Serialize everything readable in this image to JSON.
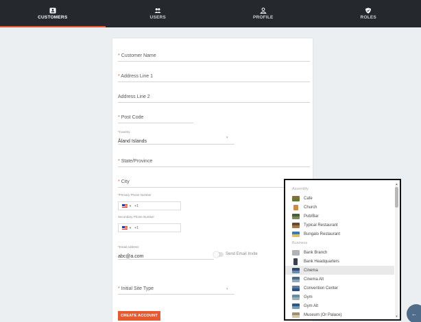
{
  "nav": {
    "tabs": [
      {
        "label": "CUSTOMERS",
        "icon": "id-card-icon",
        "active": true
      },
      {
        "label": "USERS",
        "icon": "users-icon",
        "active": false
      },
      {
        "label": "PROFILE",
        "icon": "user-icon",
        "active": false
      },
      {
        "label": "ROLES",
        "icon": "shield-icon",
        "active": false
      }
    ]
  },
  "form": {
    "customer_name": {
      "label": "Customer Name",
      "required": "*"
    },
    "address1": {
      "label": "Address Line 1",
      "required": "*"
    },
    "address2": {
      "label": "Address Line 2"
    },
    "post_code": {
      "label": "Post Code",
      "required": "*"
    },
    "country": {
      "label": "Country",
      "required": "*",
      "value": "Åland Islands"
    },
    "state": {
      "label": "State/Province",
      "required": "*"
    },
    "city": {
      "label": "City",
      "required": "*"
    },
    "primary_phone": {
      "label": "Primary Phone Number",
      "required": "*",
      "code": "+1"
    },
    "secondary_phone": {
      "label": "Secondary Phone Number",
      "code": "+1"
    },
    "email": {
      "label": "Email Address",
      "required": "*",
      "value": "abc@a.com"
    },
    "invite_toggle": {
      "label": "Send Email Invite"
    },
    "site_type": {
      "label": "Initial Site Type",
      "required": "*"
    },
    "create_button": "CREATE ACCOUNT"
  },
  "site_type_dropdown": {
    "groups": [
      {
        "name": "Assembly",
        "items": [
          "Cafe",
          "Church",
          "Pub/Bar",
          "Typical Restaurant",
          "Bungalo Restaurant"
        ]
      },
      {
        "name": "Business",
        "items": [
          "Bank Branch",
          "Bank Headquarters",
          "Cinema",
          "Cinema Alt",
          "Convention Center",
          "Gym",
          "Gym Alt",
          "Museum (Or Palace)"
        ]
      }
    ],
    "highlighted": "Cinema"
  },
  "colors": {
    "accent": "#e45b32",
    "nav_bg": "#25282c",
    "page_bg": "#eceff1"
  },
  "fab": {
    "icon": "arrow-left-icon"
  }
}
